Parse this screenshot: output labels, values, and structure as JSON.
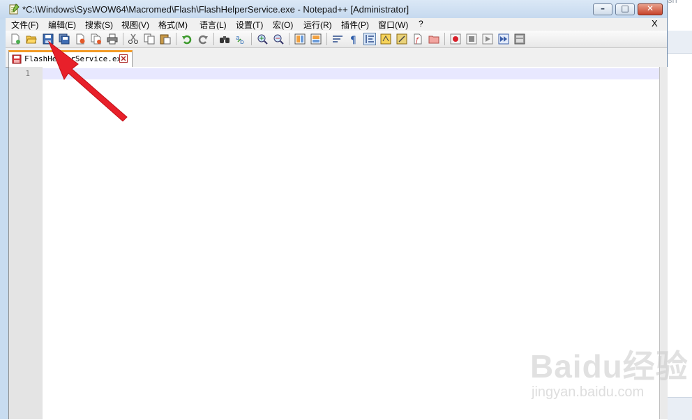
{
  "window": {
    "title": "*C:\\Windows\\SysWOW64\\Macromed\\Flash\\FlashHelperService.exe - Notepad++ [Administrator]",
    "buttons": {
      "minimize": "–",
      "maximize": "□",
      "close": "✕"
    }
  },
  "menu": {
    "items": [
      "文件(F)",
      "编辑(E)",
      "搜索(S)",
      "视图(V)",
      "格式(M)",
      "语言(L)",
      "设置(T)",
      "宏(O)",
      "运行(R)",
      "插件(P)",
      "窗口(W)",
      "?"
    ],
    "close_doc": "X"
  },
  "toolbar": {
    "icons": [
      "new-file-icon",
      "open-file-icon",
      "save-icon",
      "save-all-icon",
      "close-icon",
      "close-all-icon",
      "print-icon",
      "cut-icon",
      "copy-icon",
      "paste-icon",
      "undo-icon",
      "redo-icon",
      "find-icon",
      "replace-icon",
      "zoom-in-icon",
      "zoom-out-icon",
      "sync-vertical-icon",
      "sync-horizontal-icon",
      "word-wrap-icon",
      "show-all-chars-icon",
      "indent-guide-icon",
      "user-language-icon",
      "doc-map-icon",
      "function-list-icon",
      "folder-workspace-icon",
      "record-macro-icon",
      "stop-macro-icon",
      "play-macro-icon",
      "run-macro-multiple-icon",
      "save-macro-icon"
    ]
  },
  "tab": {
    "label": "FlashHelperService.exe"
  },
  "editor": {
    "line_numbers": [
      "1"
    ]
  },
  "background": {
    "right_text": "sh"
  },
  "watermark": {
    "logo": "Baidu经验",
    "url": "jingyan.baidu.com"
  },
  "colors": {
    "tab_accent": "#f39a25",
    "arrow": "#e8202a",
    "current_line": "#e8e8ff"
  }
}
